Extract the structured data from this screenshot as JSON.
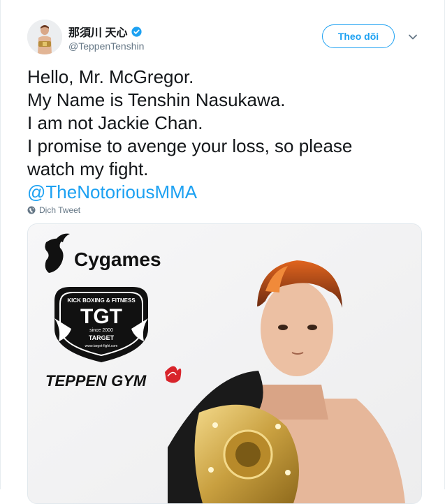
{
  "user": {
    "display_name": "那須川 天心",
    "handle": "@TeppenTenshin",
    "verified": true
  },
  "actions": {
    "follow_label": "Theo dõi",
    "menu_icon": "chevron-down-icon"
  },
  "tweet": {
    "lines": [
      "Hello, Mr. McGregor.",
      "My Name is Tenshin Nasukawa.",
      "I am not Jackie Chan.",
      "I promise to avenge your loss, so please",
      "watch my fight."
    ],
    "mention": "@TheNotoriousMMA",
    "translate_label": "Dịch Tweet"
  },
  "media": {
    "brand": "Cygames",
    "badge": {
      "top_text": "KICK BOXING & FITNESS",
      "letters": "TGT",
      "since": "since 2000",
      "name": "TARGET",
      "url": "www.target-fight.com"
    },
    "gym": "TEPPEN GYM"
  },
  "colors": {
    "accent": "#1da1f2",
    "text": "#14171a",
    "muted": "#657786",
    "border": "#e1e8ed"
  }
}
